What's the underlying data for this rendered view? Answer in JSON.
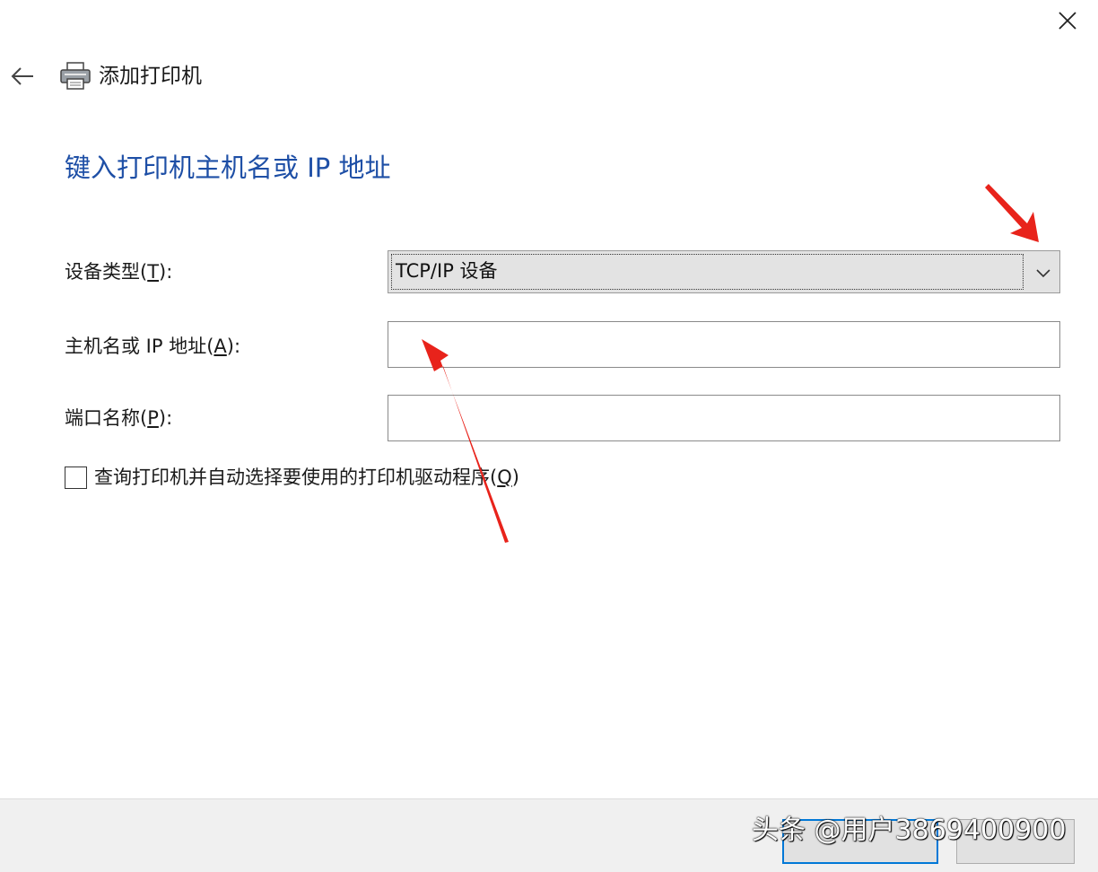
{
  "window": {
    "title": "添加打印机"
  },
  "page": {
    "heading": "键入打印机主机名或 IP 地址"
  },
  "form": {
    "device_type": {
      "label": "设备类型",
      "access_key": "T",
      "selected": "TCP/IP 设备"
    },
    "host": {
      "label": "主机名或 IP 地址",
      "access_key": "A",
      "value": ""
    },
    "port": {
      "label": "端口名称",
      "access_key": "P",
      "value": ""
    },
    "query_driver": {
      "label": "查询打印机并自动选择要使用的打印机驱动程序",
      "access_key": "Q",
      "checked": false
    }
  },
  "watermark": {
    "text": "头条 @用户3869400900"
  },
  "colors": {
    "heading": "#1e4fa6",
    "focus_border": "#0078d7",
    "annotation_arrow": "#e8231b"
  }
}
